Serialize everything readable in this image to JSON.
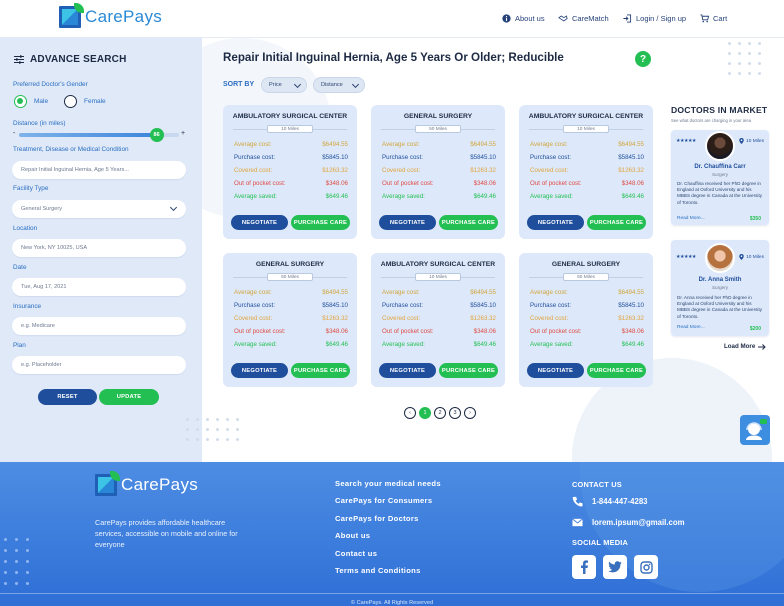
{
  "brand": {
    "name": "CarePays"
  },
  "nav": {
    "about": "About us",
    "caremateh": "CareMatch",
    "login": "Login / Sign up",
    "cart": "Cart"
  },
  "sidebar": {
    "title": "ADVANCE SEARCH",
    "gender_label": "Preferred Doctor's Gender",
    "male": "Male",
    "female": "Female",
    "selected_gender": "Male",
    "distance_label": "Distance (in miles)",
    "distance_value": "86",
    "distance_fraction": 0.86,
    "minus": "-",
    "plus": "+",
    "treatment_label": "Treatment, Disease or Medical Condition",
    "treatment_value": "Repair Initial Inguinal Hernia, Age 5 Years...",
    "facility_label": "Facility Type",
    "facility_value": "General Surgery",
    "location_label": "Location",
    "location_value": "New York, NY 10025, USA",
    "date_label": "Date",
    "date_value": "Tue, Aug 17, 2021",
    "insurance_label": "Insurance",
    "insurance_placeholder": "e.g. Medicare",
    "plan_label": "Plan",
    "plan_placeholder": "e.g. Placeholder",
    "reset": "RESET",
    "update": "UPDATE"
  },
  "main": {
    "title": "Repair Initial Inguinal Hernia, Age 5 Years Or Older; Reducible",
    "help": "?",
    "sort_by": "SORT BY",
    "sort_price": "Price",
    "sort_distance": "Distance"
  },
  "labels": {
    "average": "Average cost:",
    "purchase": "Purchase cost:",
    "covered": "Covered cost:",
    "oop": "Out of pocket cost:",
    "saved": "Average saved:",
    "negotiate": "NEGOTIATE",
    "purchase_btn": "PURCHASE CARE"
  },
  "cards": [
    {
      "title": "AMBULATORY SURGICAL CENTER",
      "distance": "10 Miles",
      "average": "$6494.55",
      "purchase": "$5845.10",
      "covered": "$1263.32",
      "oop": "$348.06",
      "saved": "$649.46"
    },
    {
      "title": "GENERAL SURGERY",
      "distance": "50 Miles",
      "average": "$6494.55",
      "purchase": "$5845.10",
      "covered": "$1263.32",
      "oop": "$348.06",
      "saved": "$649.46"
    },
    {
      "title": "AMBULATORY SURGICAL CENTER",
      "distance": "10 Miles",
      "average": "$6494.55",
      "purchase": "$5845.10",
      "covered": "$1263.32",
      "oop": "$348.06",
      "saved": "$649.46"
    },
    {
      "title": "GENERAL SURGERY",
      "distance": "50 Miles",
      "average": "$6494.55",
      "purchase": "$5845.10",
      "covered": "$1263.32",
      "oop": "$348.06",
      "saved": "$649.46"
    },
    {
      "title": "AMBULATORY SURGICAL CENTER",
      "distance": "10 Miles",
      "average": "$6494.55",
      "purchase": "$5845.10",
      "covered": "$1263.32",
      "oop": "$348.06",
      "saved": "$649.46"
    },
    {
      "title": "GENERAL SURGERY",
      "distance": "50 Miles",
      "average": "$6494.55",
      "purchase": "$5845.10",
      "covered": "$1263.32",
      "oop": "$348.06",
      "saved": "$649.46"
    }
  ],
  "pagination": {
    "pages": [
      "1",
      "2",
      "3"
    ],
    "current": "1",
    "prev": "‹",
    "next": "›"
  },
  "doctors": {
    "title": "DOCTORS IN MARKET",
    "subtitle": "See what doctors are charging in your area",
    "load_more": "Load More",
    "items": [
      {
        "name": "Dr. Chauffina Carr",
        "specialty": "Surgery",
        "miles": "10 Miles",
        "stars": "★★★★★",
        "bio": "Dr. Chauffina received her PhD degree in England at Oxford University and his MBBS degree in Canada at the University of Toronto.",
        "read_more": "Read More...",
        "price": "$350"
      },
      {
        "name": "Dr. Anna Smith",
        "specialty": "Surgery",
        "miles": "10 Miles",
        "stars": "★★★★★",
        "bio": "Dr. Anna received her PhD degree in England at Oxford University and his MBBS degree in Canada at the University of Toronto.",
        "read_more": "Read More...",
        "price": "$200"
      }
    ]
  },
  "footer": {
    "tagline": "CarePays provides affordable healthcare services, accessible on mobile and online for everyone",
    "links": [
      "Search your medical needs",
      "CarePays for Consumers",
      "CarePays for Doctors",
      "About us",
      "Contact us",
      "Terms and Conditions"
    ],
    "contact_title": "CONTACT US",
    "phone": "1-844-447-4283",
    "email": "lorem.ipsum@gmail.com",
    "social_title": "SOCIAL MEDIA",
    "copyright": "© CarePays. All Rights Reserved"
  },
  "colors": {
    "green": "#23bf52",
    "navy": "#1f4e9c",
    "footer": "#3a7ddc"
  }
}
